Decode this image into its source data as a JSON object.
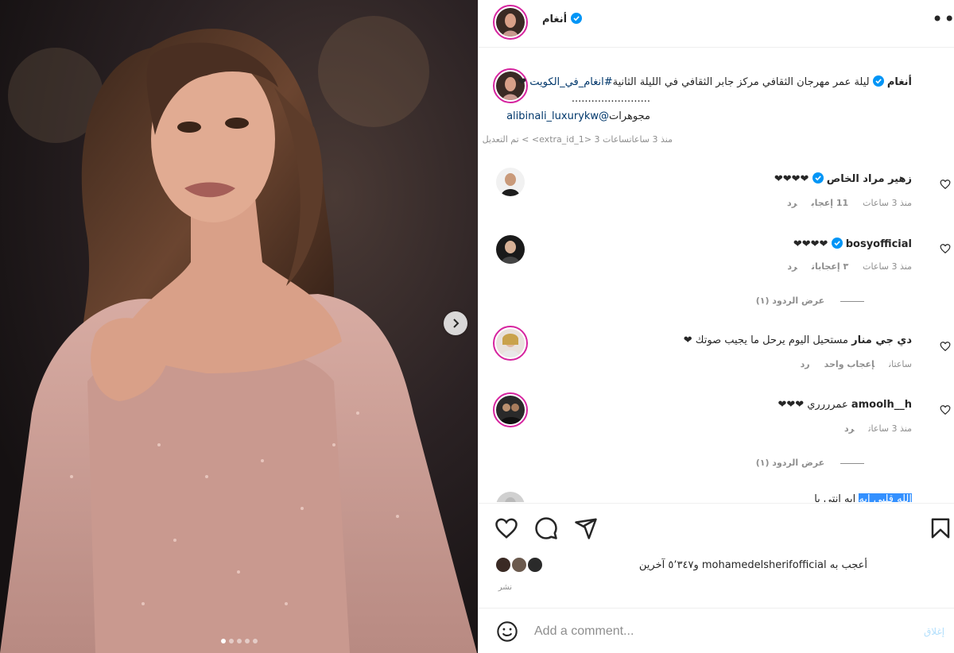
{
  "owner": {
    "name": "أنغام"
  },
  "caption": {
    "username": "أنغام",
    "text": "ليلة عمر مهرجان الثقافي مركز جابر الثقافي في الليلة الثانية",
    "hashtag": "#انغام_في_الكويت",
    "heart": "❤",
    "dots": "........................",
    "jewelry_label": "مجوهرات",
    "mention": "@alibinali_luxurykw",
    "meta": "منذ 3 ساعاتساعات 3 <extra_id_1> > تم التعديل"
  },
  "comments": [
    {
      "username": "زهير مراد الخاص",
      "text": "❤❤❤❤",
      "time": "منذ 3 ساعات",
      "likes": "11 إعجاب",
      "reply": "رد"
    },
    {
      "username": "bosyofficial",
      "text": "❤❤❤❤",
      "time": "منذ 3 ساعات",
      "likes": "٣ إعجابات",
      "reply": "رد",
      "view_replies": "عرض الردود (١)"
    },
    {
      "username": "دي جي منار",
      "text": "مستحيل اليوم يرحل ما يجيب صوتك ❤",
      "time": "ساعتان",
      "likes": "إعجاب واحد",
      "reply": "رد"
    },
    {
      "username": "amoolh__h",
      "text": "عمرررري ❤❤❤",
      "time": "منذ 3 ساعات",
      "reply": "رد",
      "view_replies": "عرض الردود (١)"
    }
  ],
  "partial_comment": {
    "text": "ايه انتي يا",
    "highlighted": "الله قلبي ايه"
  },
  "likes": {
    "text": "أعجب به mohamedelsherifofficial و٥٬٣٤٧ آخرين"
  },
  "share_label": "نشر",
  "add_comment": {
    "placeholder": "Add a comment...",
    "post_label": "إغلاق"
  },
  "colors": {
    "accent": "#0095f6",
    "verified": "#0095f6",
    "ring": "#d6249f",
    "dress": "#c9998f"
  },
  "carousel": {
    "slides": 5,
    "active": 1
  }
}
